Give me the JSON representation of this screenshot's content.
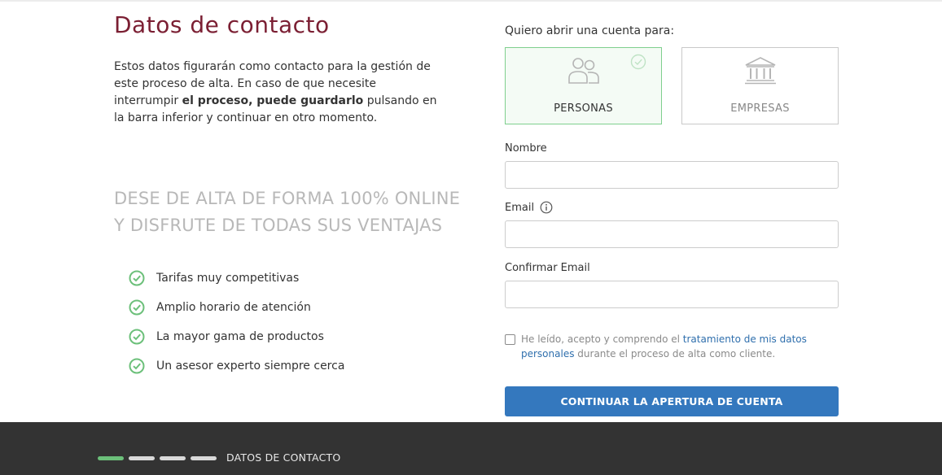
{
  "page": {
    "title": "Datos de contacto",
    "intro_1": "Estos datos figurarán como contacto para la gestión de este proceso de alta. En caso de que necesite interrumpir ",
    "intro_bold": "el proceso, puede guardarlo",
    "intro_2": " pulsando en la barra inferior y continuar en otro momento.",
    "promo_line1": "DESE DE ALTA DE FORMA 100% ONLINE",
    "promo_line2": "Y DISFRUTE DE TODAS SUS VENTAJAS",
    "benefits": [
      "Tarifas muy competitivas",
      "Amplio horario de atención",
      "La mayor gama de productos",
      "Un asesor experto siempre cerca"
    ]
  },
  "form": {
    "account_prompt": "Quiero abrir una cuenta para:",
    "account_types": [
      {
        "label": "PERSONAS",
        "icon": "people-icon",
        "selected": true
      },
      {
        "label": "EMPRESAS",
        "icon": "bank-icon",
        "selected": false
      }
    ],
    "fields": {
      "nombre": {
        "label": "Nombre",
        "value": "",
        "placeholder": ""
      },
      "email": {
        "label": "Email",
        "value": "",
        "placeholder": ""
      },
      "confirm_email": {
        "label": "Confirmar Email",
        "value": "",
        "placeholder": ""
      }
    },
    "consent": {
      "checked": false,
      "text_before": "He leído, acepto y comprendo el ",
      "link": "tratamiento de mis datos personales",
      "text_after": " durante el proceso de alta como cliente."
    },
    "submit_label": "CONTINUAR LA APERTURA DE CUENTA"
  },
  "footer": {
    "step_label": "DATOS DE CONTACTO",
    "progress": {
      "current_step": 1,
      "total_steps": 4
    }
  },
  "colors": {
    "title": "#7b1f33",
    "accent_green": "#6cc07a",
    "button_blue": "#3478be",
    "footer_bg": "#333333"
  }
}
